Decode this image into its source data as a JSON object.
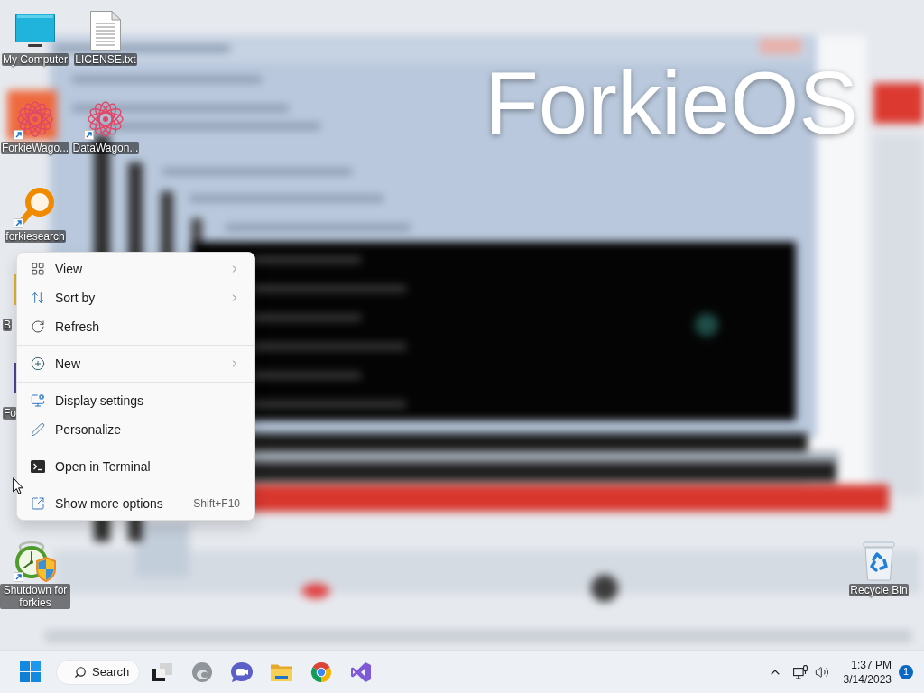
{
  "wallpaper": {
    "title": "ForkieOS"
  },
  "desktop": {
    "columns": [
      [
        {
          "label": "My Computer",
          "kind": "computer",
          "shortcut": false,
          "covered": false
        },
        {
          "label": "ForkieWago...",
          "kind": "mandala",
          "shortcut": true,
          "covered": false
        },
        {
          "label": "forkiesearch",
          "kind": "search-ring",
          "shortcut": true,
          "covered": false
        },
        {
          "label": "B",
          "kind": "folder",
          "covered": true
        },
        {
          "label": "Fo",
          "kind": "app",
          "covered": true
        }
      ],
      [
        {
          "label": "LICENSE.txt",
          "kind": "text-file",
          "shortcut": false,
          "covered": false
        },
        {
          "label": "DataWagon...",
          "kind": "mandala",
          "shortcut": true,
          "covered": false
        }
      ]
    ],
    "bottom_left": [
      {
        "label": "Shutdown for forkies",
        "kind": "shutdown",
        "shortcut": true,
        "covered": false
      }
    ],
    "bottom_right": [
      {
        "label": "Recycle Bin",
        "kind": "recycle-bin",
        "shortcut": false,
        "covered": false
      }
    ]
  },
  "context_menu": {
    "groups": [
      [
        {
          "label": "View",
          "submenu": true
        },
        {
          "label": "Sort by",
          "submenu": true
        },
        {
          "label": "Refresh",
          "submenu": false
        }
      ],
      [
        {
          "label": "New",
          "submenu": true
        }
      ],
      [
        {
          "label": "Display settings",
          "submenu": false
        },
        {
          "label": "Personalize",
          "submenu": false
        }
      ],
      [
        {
          "label": "Open in Terminal",
          "submenu": false
        }
      ],
      [
        {
          "label": "Show more options",
          "submenu": false,
          "shortcut": "Shift+F10"
        }
      ]
    ]
  },
  "taskbar": {
    "search": {
      "label": "Search"
    },
    "clock": {
      "time": "1:37 PM",
      "date": "3/14/2023"
    },
    "notification_count": "1"
  }
}
